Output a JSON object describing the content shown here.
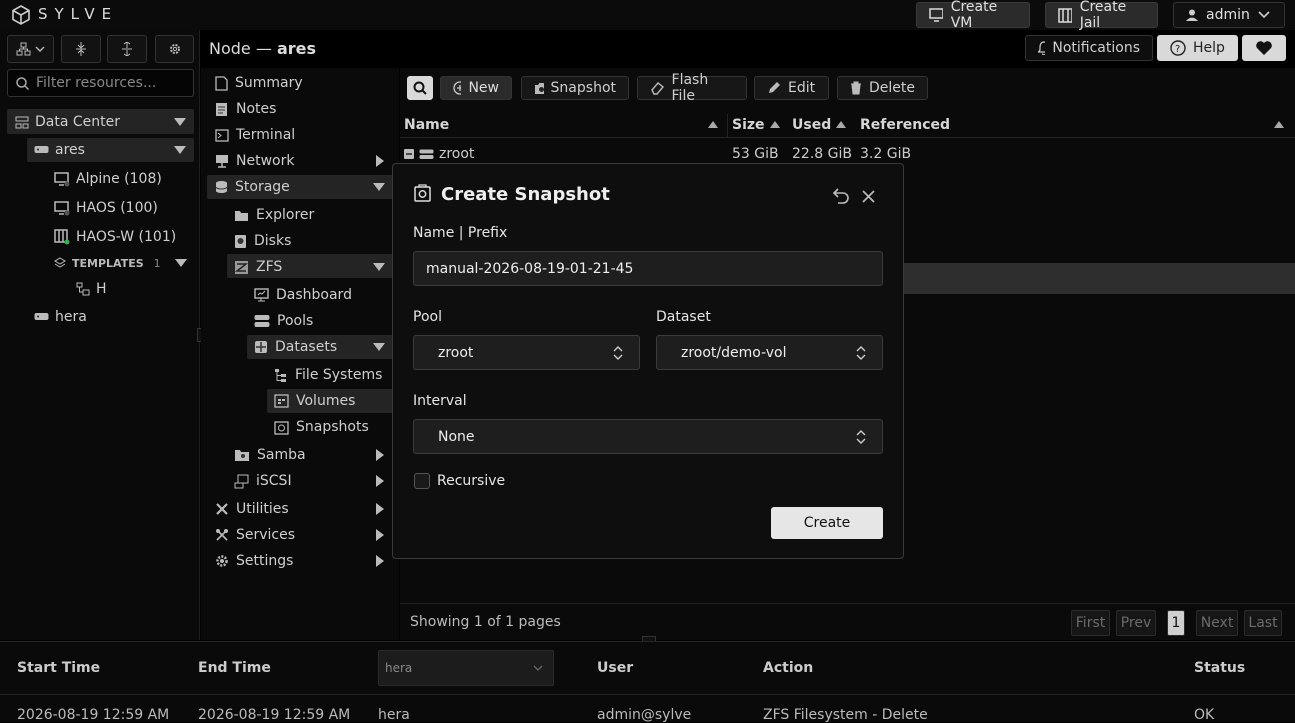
{
  "app": {
    "brand": "SYLVE",
    "create_vm": "Create VM",
    "create_jail": "Create Jail",
    "user": "admin"
  },
  "header": {
    "node_prefix": "Node —",
    "node_name": "ares",
    "notifications": "Notifications",
    "help": "Help"
  },
  "sidebar": {
    "filter_placeholder": "Filter resources...",
    "datacenter": "Data Center",
    "node": "ares",
    "vms": [
      "Alpine (108)",
      "HAOS (100)",
      "HAOS-W (101)"
    ],
    "templates_label": "TEMPLATES",
    "templates_count": "1",
    "template_item": "H",
    "other_node": "hera"
  },
  "nav": {
    "summary": "Summary",
    "notes": "Notes",
    "terminal": "Terminal",
    "network": "Network",
    "storage": "Storage",
    "explorer": "Explorer",
    "disks": "Disks",
    "zfs": "ZFS",
    "dashboard": "Dashboard",
    "pools": "Pools",
    "datasets": "Datasets",
    "file_systems": "File Systems",
    "volumes": "Volumes",
    "snapshots": "Snapshots",
    "samba": "Samba",
    "iscsi": "iSCSI",
    "utilities": "Utilities",
    "services": "Services",
    "settings": "Settings"
  },
  "toolbar": {
    "new": "New",
    "snapshot": "Snapshot",
    "flash_file": "Flash File",
    "edit": "Edit",
    "delete": "Delete"
  },
  "table": {
    "columns": [
      "Name",
      "Size",
      "Used",
      "Referenced"
    ],
    "row": {
      "name": "zroot",
      "size": "53 GiB",
      "used": "22.8 GiB",
      "referenced": "3.2 GiB"
    }
  },
  "pagination": {
    "info": "Showing 1 of 1 pages",
    "first": "First",
    "prev": "Prev",
    "current": "1",
    "next": "Next",
    "last": "Last"
  },
  "tasks": {
    "columns": {
      "start": "Start Time",
      "end": "End Time",
      "node_select": "hera",
      "user": "User",
      "action": "Action",
      "status": "Status"
    },
    "row": {
      "start": "2026-08-19 12:59 AM",
      "end": "2026-08-19 12:59 AM",
      "node": "hera",
      "user": "admin@sylve",
      "action": "ZFS Filesystem - Delete",
      "status": "OK"
    }
  },
  "modal": {
    "title": "Create Snapshot",
    "name_label": "Name | Prefix",
    "name_value": "manual-2026-08-19-01-21-45",
    "pool_label": "Pool",
    "pool_value": "zroot",
    "dataset_label": "Dataset",
    "dataset_value": "zroot/demo-vol",
    "interval_label": "Interval",
    "interval_value": "None",
    "recursive_label": "Recursive",
    "create": "Create"
  }
}
